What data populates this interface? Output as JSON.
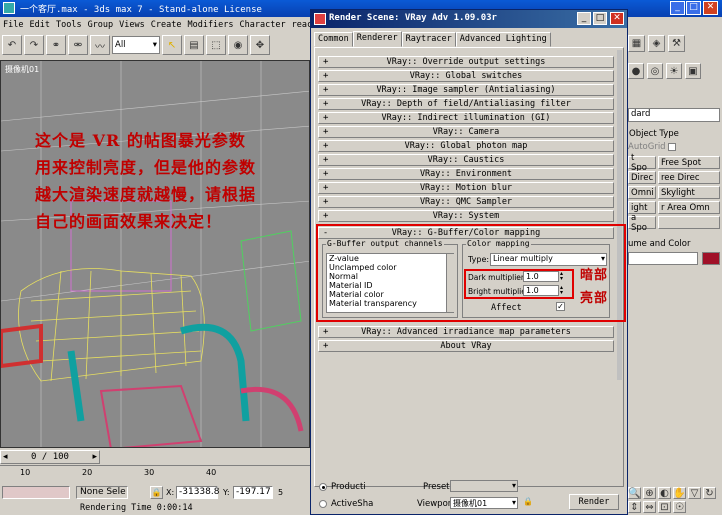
{
  "app": {
    "title": "一个客厅.max - 3ds max 7 - Stand-alone License",
    "menu": [
      "File",
      "Edit",
      "Tools",
      "Group",
      "Views",
      "Create",
      "Modifiers",
      "Character",
      "reactor"
    ],
    "selection_filter": "All",
    "viewport_label": "摄像机01",
    "timeline": "0 / 100",
    "ruler": [
      "10",
      "20",
      "30",
      "40"
    ],
    "status": {
      "selection": "None Sele",
      "x_label": "X:",
      "x_value": "-31338.8",
      "y_label": "Y:",
      "y_value": "-197.17",
      "z_label": "5",
      "render_time": "Rendering Time  0:00:14"
    }
  },
  "dialog": {
    "title": "Render Scene: VRay Adv 1.09.03r",
    "tabs": [
      "Common",
      "Renderer",
      "Raytracer",
      "Advanced Lighting"
    ],
    "rollouts": [
      "VRay:: Override output settings",
      "VRay:: Global switches",
      "VRay:: Image sampler (Antialiasing)",
      "VRay:: Depth of field/Antialiasing filter",
      "VRay:: Indirect illumination (GI)",
      "VRay:: Camera",
      "VRay:: Global photon map",
      "VRay:: Caustics",
      "VRay:: Environment",
      "VRay:: Motion blur",
      "VRay:: QMC Sampler",
      "VRay:: System"
    ],
    "open_rollout": "VRay:: G-Buffer/Color mapping",
    "gbuffer": {
      "label": "G-Buffer output channels",
      "items": [
        "Z-value",
        "Unclamped color",
        "Normal",
        "Material ID",
        "Material color",
        "Material transparency"
      ]
    },
    "color_mapping": {
      "label": "Color mapping",
      "type_label": "Type:",
      "type_value": "Linear multiply",
      "dark_label": "Dark multiplier:",
      "dark_value": "1.0",
      "bright_label": "Bright multiplier:",
      "bright_value": "1.0",
      "affect_label": "Affect"
    },
    "rollouts_after": [
      "VRay:: Advanced irradiance map parameters",
      "About VRay"
    ],
    "bottom": {
      "radio1": "Producti",
      "radio2": "ActiveSha",
      "preset_label": "Preset:",
      "viewport_label": "Viewport:",
      "viewport_value": "摄像机01",
      "render_button": "Render"
    }
  },
  "right_panel": {
    "dropdown": "dard",
    "rollout_obj": "Object Type",
    "autogrid": "AutoGrid",
    "buttons": [
      [
        "t Spo",
        "Free Spot"
      ],
      [
        "Direc",
        "ree Direc"
      ],
      [
        "Omni",
        "Skylight"
      ],
      [
        "ight",
        "r Area Omn"
      ],
      [
        "a Spo",
        ""
      ]
    ],
    "rollout_name": "ume and Color"
  },
  "annotation": {
    "lines": [
      "这个是 VR 的帖图暴光参数",
      "用来控制亮度，但是他的参数",
      "越大渲染速度就越慢，请根据",
      "自己的画面效果来决定！"
    ],
    "dark_note": "暗部",
    "bright_note": "亮部"
  },
  "colors": {
    "accent": "#c00000",
    "titlebar": "#0a246a"
  }
}
